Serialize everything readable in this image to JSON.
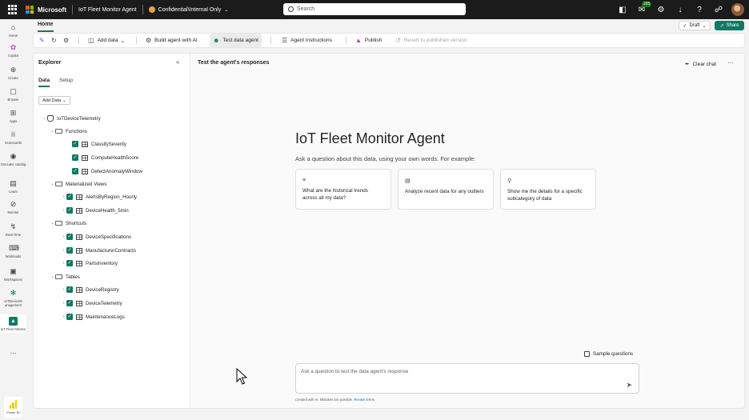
{
  "topbar": {
    "brand": "Microsoft",
    "item_name": "IoT Fleet Monitor Agent",
    "sensitivity": "Confidential\\Internal Only",
    "search_placeholder": "Search",
    "notifications_count": "225"
  },
  "left_rail": {
    "items": [
      {
        "label": "Home",
        "icon": "home-icon"
      },
      {
        "label": "Copilot",
        "icon": "copilot-icon"
      },
      {
        "label": "Create",
        "icon": "plus-circle-icon"
      },
      {
        "label": "Browse",
        "icon": "folder-icon"
      },
      {
        "label": "Apps",
        "icon": "apps-icon"
      },
      {
        "label": "Scorecards",
        "icon": "trophy-icon"
      },
      {
        "label": "OneLake catalog",
        "icon": "onelake-icon"
      },
      {
        "label": "Learn",
        "icon": "book-icon"
      },
      {
        "label": "Monitor",
        "icon": "monitor-icon"
      },
      {
        "label": "Real-Time",
        "icon": "lightning-icon"
      },
      {
        "label": "Workloads",
        "icon": "workloads-icon"
      },
      {
        "label": "Workspaces",
        "icon": "workspaces-icon"
      },
      {
        "label": "IoTDeviceM anagement",
        "icon": "iot-icon"
      },
      {
        "label": "IoT Fleet Monitor",
        "icon": "agent-icon"
      }
    ],
    "more": "...",
    "powerbi_label": "Power BI"
  },
  "ribbon": {
    "tab": "Home",
    "draft_label": "Draft",
    "share_label": "Share",
    "tools": {
      "add_data": "Add data",
      "build_agent": "Build agent with AI",
      "test_agent": "Test data agent",
      "agent_instructions": "Agent instructions",
      "publish": "Publish",
      "revert": "Revert to published version"
    }
  },
  "explorer": {
    "title": "Explorer",
    "tabs": [
      "Data",
      "Setup"
    ],
    "add_data_btn": "Add Data",
    "database": "IoTDeviceTelemetry",
    "groups": {
      "functions": {
        "label": "Functions",
        "items": [
          "ClassifySeverity",
          "ComputeHealthScore",
          "DetectAnomalyWindow"
        ]
      },
      "views": {
        "label": "Materialized Views",
        "items": [
          "AlertsByRegion_Hourly",
          "DeviceHealth_5min"
        ]
      },
      "shortcuts": {
        "label": "Shortcuts",
        "items": [
          "DeviceSpecifications",
          "ManufacturerContracts",
          "PartsInventory"
        ]
      },
      "tables": {
        "label": "Tables",
        "items": [
          "DeviceRegistry",
          "DeviceTelemetry",
          "MaintenanceLogs"
        ]
      }
    }
  },
  "main": {
    "title": "Test the agent's responses",
    "clear_chat": "Clear chat",
    "agent_name": "IoT Fleet Monitor Agent",
    "subtitle": "Ask a question about this data, using your own words. For example:",
    "cards": [
      "What are the historical trends across all my data?",
      "Analyze recent data for any outliers",
      "Show me the details for a specific subcategory of data"
    ],
    "sample_questions": "Sample questions",
    "input_placeholder": "Ask a question to test the data agent's response",
    "disclaimer": "Created with AI. Mistakes are possible.",
    "disclaimer_link": "Review terms"
  },
  "colors": {
    "accent": "#117865",
    "topbar": "#1b1b1b"
  }
}
